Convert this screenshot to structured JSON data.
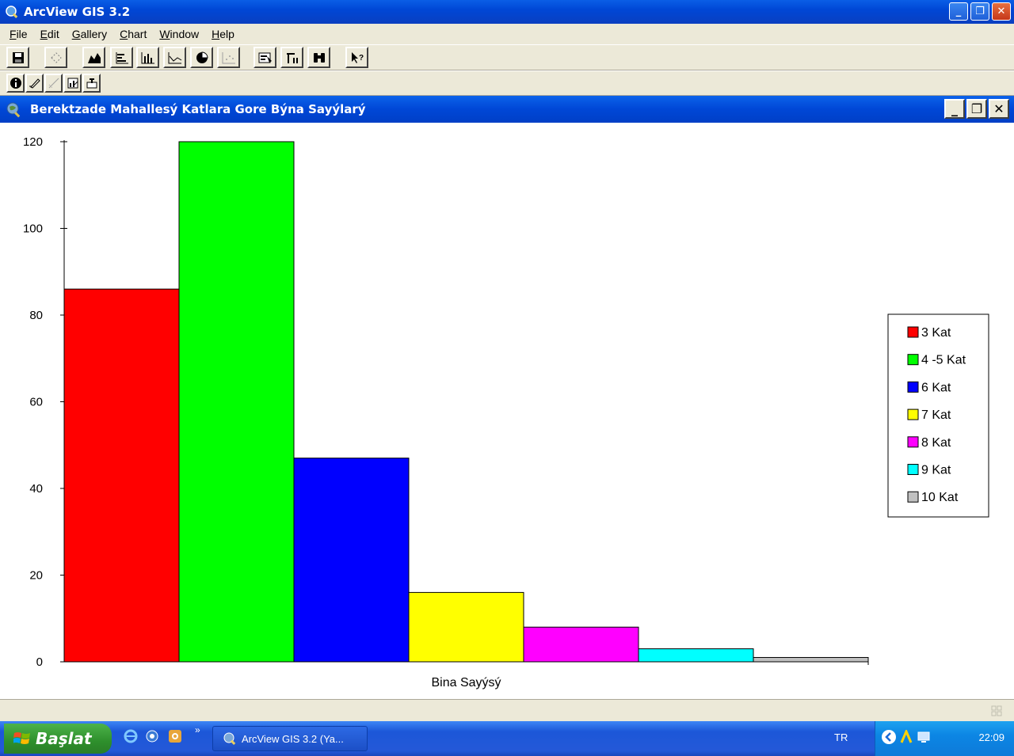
{
  "window": {
    "title": "ArcView GIS 3.2",
    "controls": {
      "minimize": "_",
      "restore": "❐",
      "close": "✕"
    }
  },
  "menu": [
    "File",
    "Edit",
    "Gallery",
    "Chart",
    "Window",
    "Help"
  ],
  "document": {
    "title": "Berektzade Mahallesý Katlara Gore Býna Sayýlarý",
    "controls": {
      "minimize": "_",
      "restore": "❐",
      "close": "✕"
    }
  },
  "chart_data": {
    "type": "bar",
    "title": "",
    "xlabel": "Bina Sayýsý",
    "ylabel": "",
    "ylim": [
      0,
      120
    ],
    "yticks": [
      0,
      20,
      40,
      60,
      80,
      100,
      120
    ],
    "legend_position": "right",
    "series": [
      {
        "name": "3 Kat",
        "value": 86,
        "color": "#ff0000"
      },
      {
        "name": "4 -5 Kat",
        "value": 120,
        "color": "#00ff00"
      },
      {
        "name": "6 Kat",
        "value": 47,
        "color": "#0000ff"
      },
      {
        "name": "7 Kat",
        "value": 16,
        "color": "#ffff00"
      },
      {
        "name": "8 Kat",
        "value": 8,
        "color": "#ff00ff"
      },
      {
        "name": "9 Kat",
        "value": 3,
        "color": "#00ffff"
      },
      {
        "name": "10 Kat",
        "value": 1,
        "color": "#c0c0c0"
      }
    ]
  },
  "taskbar": {
    "start_label": "Başlat",
    "task_label": "ArcView GIS 3.2  (Ya...",
    "language": "TR",
    "clock": "22:09"
  }
}
